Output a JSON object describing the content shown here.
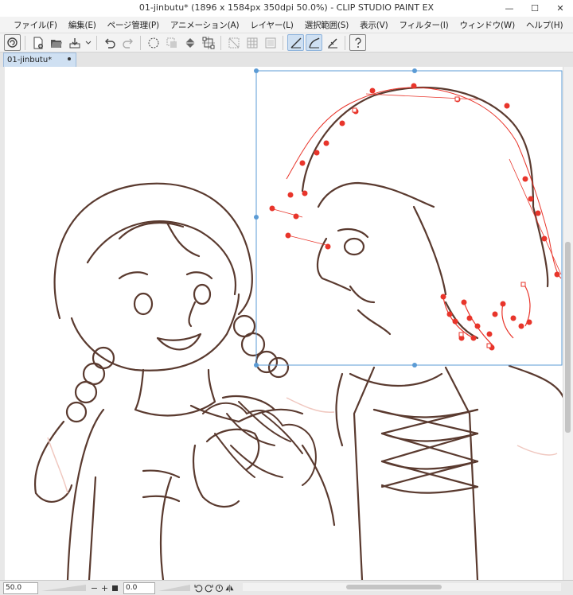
{
  "window": {
    "title": "01-jinbutu* (1896 x 1584px 350dpi 50.0%)  - CLIP STUDIO PAINT EX",
    "minimize": "—",
    "maximize": "☐",
    "close": "✕"
  },
  "menu": [
    "ファイル(F)",
    "編集(E)",
    "ページ管理(P)",
    "アニメーション(A)",
    "レイヤー(L)",
    "選択範囲(S)",
    "表示(V)",
    "フィルター(I)",
    "ウィンドウ(W)",
    "ヘルプ(H)"
  ],
  "toolbar": {
    "icons": [
      "clip-studio-logo-icon",
      "new-file-icon",
      "open-file-icon",
      "save-icon",
      "undo-icon",
      "redo-icon",
      "deselect-icon",
      "invert-selection-icon",
      "fill-icon",
      "transform-icon",
      "hide-selection-icon",
      "grid-icon",
      "border-icon",
      "vector-line-icon",
      "vector-curve-icon",
      "vector-correct-icon",
      "help-icon"
    ]
  },
  "tab": {
    "label": "01-jinbutu*"
  },
  "status": {
    "zoom": "50.0",
    "rotate": "0.0",
    "zoom_out": "−",
    "zoom_in": "+"
  },
  "colors": {
    "accent": "#5b9bd5",
    "vector_point": "#e8352b",
    "line_art": "#5a3a2f"
  }
}
